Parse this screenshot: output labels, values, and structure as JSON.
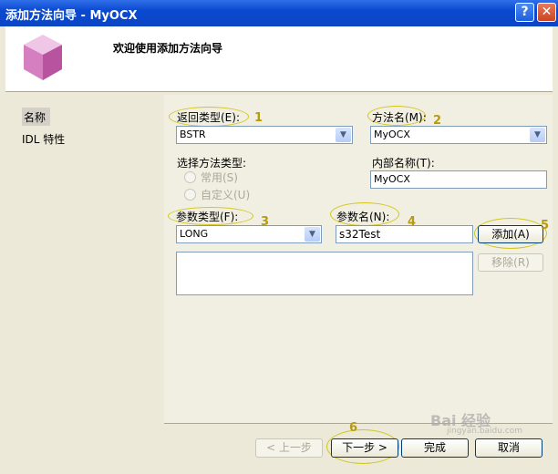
{
  "window": {
    "title": "添加方法向导 - MyOCX",
    "help": "?",
    "close": "✕"
  },
  "header": {
    "title": "欢迎使用添加方法向导"
  },
  "nav": {
    "items": [
      "名称",
      "IDL 特性"
    ]
  },
  "form": {
    "return_type_label": "返回类型(E):",
    "return_type_value": "BSTR",
    "method_name_label": "方法名(M):",
    "method_name_value": "MyOCX",
    "method_type_label": "选择方法类型:",
    "radio_common": "常用(S)",
    "radio_custom": "自定义(U)",
    "internal_name_label": "内部名称(T):",
    "internal_name_value": "MyOCX",
    "param_type_label": "参数类型(F):",
    "param_type_value": "LONG",
    "param_name_label": "参数名(N):",
    "param_name_value": "s32Test",
    "add_button": "添加(A)",
    "remove_button": "移除(R)"
  },
  "footer": {
    "prev": "< 上一步",
    "next": "下一步 >",
    "finish": "完成",
    "cancel": "取消"
  },
  "annotations": [
    "1",
    "2",
    "3",
    "4",
    "5",
    "6"
  ],
  "watermark": {
    "text": "Bai 经验",
    "subtext": "jingyan.baidu.com"
  }
}
